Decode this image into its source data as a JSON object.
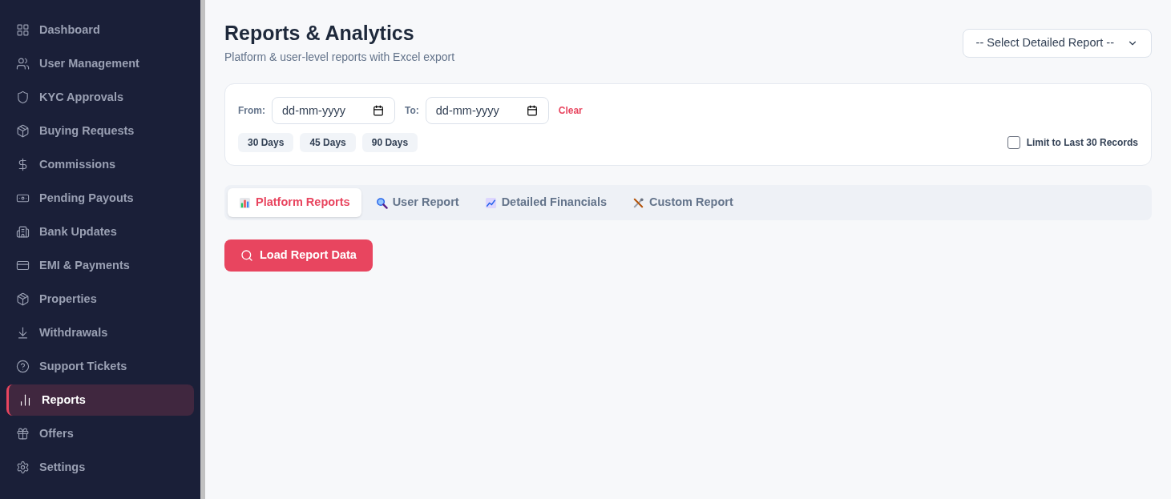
{
  "sidebar": {
    "items": [
      {
        "label": "Dashboard",
        "kind": "grid",
        "selected": false
      },
      {
        "label": "User Management",
        "kind": "users",
        "selected": false
      },
      {
        "label": "KYC Approvals",
        "kind": "shield",
        "selected": false
      },
      {
        "label": "Buying Requests",
        "kind": "box",
        "selected": false
      },
      {
        "label": "Commissions",
        "kind": "dollar",
        "selected": false
      },
      {
        "label": "Pending Payouts",
        "kind": "cash",
        "selected": false
      },
      {
        "label": "Bank Updates",
        "kind": "bank",
        "selected": false
      },
      {
        "label": "EMI & Payments",
        "kind": "card",
        "selected": false
      },
      {
        "label": "Properties",
        "kind": "box",
        "selected": false
      },
      {
        "label": "Withdrawals",
        "kind": "download",
        "selected": false
      },
      {
        "label": "Support Tickets",
        "kind": "help",
        "selected": false
      },
      {
        "label": "Reports",
        "kind": "chart",
        "selected": true
      },
      {
        "label": "Offers",
        "kind": "gift",
        "selected": false
      },
      {
        "label": "Settings",
        "kind": "gear",
        "selected": false
      }
    ]
  },
  "header": {
    "title": "Reports & Analytics",
    "subtitle": "Platform & user-level reports with Excel export",
    "report_select": {
      "value": "-- Select Detailed Report --"
    }
  },
  "filters": {
    "from": {
      "label": "From:",
      "placeholder": "dd-mm-yyyy"
    },
    "to": {
      "label": "To:",
      "placeholder": "dd-mm-yyyy"
    },
    "clear": "Clear",
    "presets": [
      "30 Days",
      "45 Days",
      "90 Days"
    ],
    "limit": {
      "label": "Limit to Last 30 Records",
      "checked": false
    }
  },
  "tabs": [
    {
      "label": "Platform Reports",
      "kind": "bars",
      "selected": true
    },
    {
      "label": "User Report",
      "kind": "search",
      "selected": false
    },
    {
      "label": "Detailed Financials",
      "kind": "trend",
      "selected": false
    },
    {
      "label": "Custom Report",
      "kind": "tools",
      "selected": false
    }
  ],
  "load_button": "Load Report Data"
}
